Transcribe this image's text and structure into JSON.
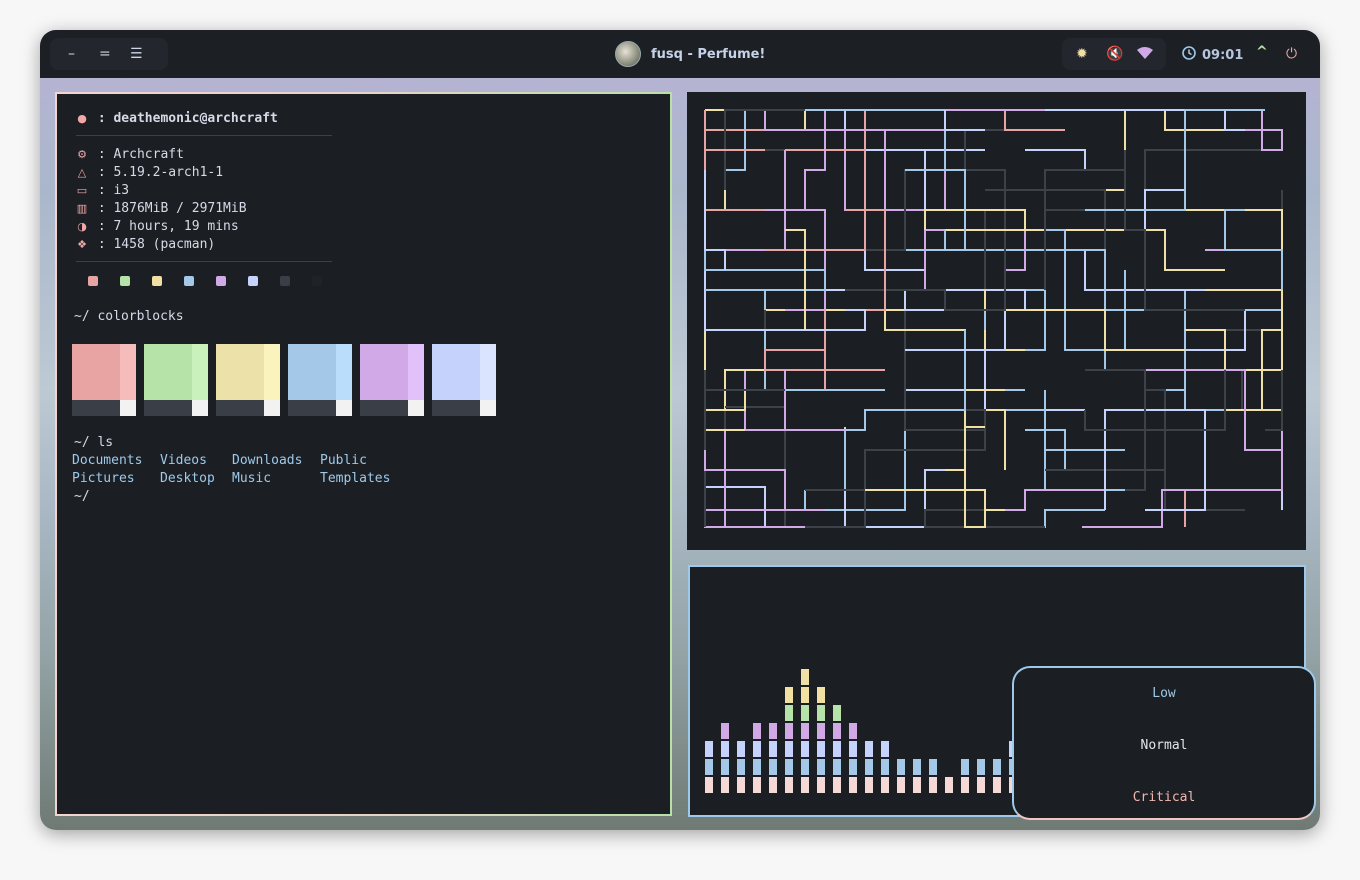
{
  "topbar": {
    "workspace_icons": [
      "minus-icon",
      "equals-icon",
      "menu-icon"
    ],
    "window_title": "fusq - Perfume!",
    "tray_icons": [
      "brightness-icon",
      "mute-icon",
      "wifi-icon"
    ],
    "clock": "09:01",
    "buttons": [
      "chevron-up-icon",
      "power-icon"
    ]
  },
  "terminal": {
    "user": "deathemonic@archcraft",
    "info": [
      {
        "icon": "gear-icon",
        "label": "Archcraft"
      },
      {
        "icon": "linux-icon",
        "label": "5.19.2-arch1-1"
      },
      {
        "icon": "window-icon",
        "label": "i3"
      },
      {
        "icon": "memory-icon",
        "label": "1876MiB / 2971MiB"
      },
      {
        "icon": "uptime-icon",
        "label": "7 hours, 19 mins"
      },
      {
        "icon": "package-icon",
        "label": "1458 (pacman)"
      }
    ],
    "palette_dots": [
      "#e8a3a3",
      "#b5e3a8",
      "#f1e0a3",
      "#a3c8e8",
      "#d1a9e6",
      "#c5d2fb",
      "#3a3e46",
      "#1f2227"
    ],
    "cmd1": "~/ colorblocks",
    "colorblocks": [
      {
        "main": "#e8a3a3",
        "side": "#f6bcbc"
      },
      {
        "main": "#b5e3a8",
        "side": "#c8f1bc"
      },
      {
        "main": "#ece1a9",
        "side": "#fbf3bd"
      },
      {
        "main": "#a3c8e8",
        "side": "#b9ddfa"
      },
      {
        "main": "#d1a9e6",
        "side": "#e2c0fa"
      },
      {
        "main": "#c5d2fb",
        "side": "#dbe4fe"
      }
    ],
    "cmd2": "~/ ls",
    "ls_rows": [
      [
        "Documents",
        "Videos",
        "Downloads",
        "Public"
      ],
      [
        "Pictures",
        "Desktop",
        "Music",
        "Templates"
      ]
    ],
    "prompt": "~/"
  },
  "popup": {
    "low": "Low",
    "normal": "Normal",
    "critical": "Critical"
  },
  "colors": {
    "low": "#9ec9ea",
    "normal": "#e3e6ec",
    "critical": "#f2b7b0"
  }
}
